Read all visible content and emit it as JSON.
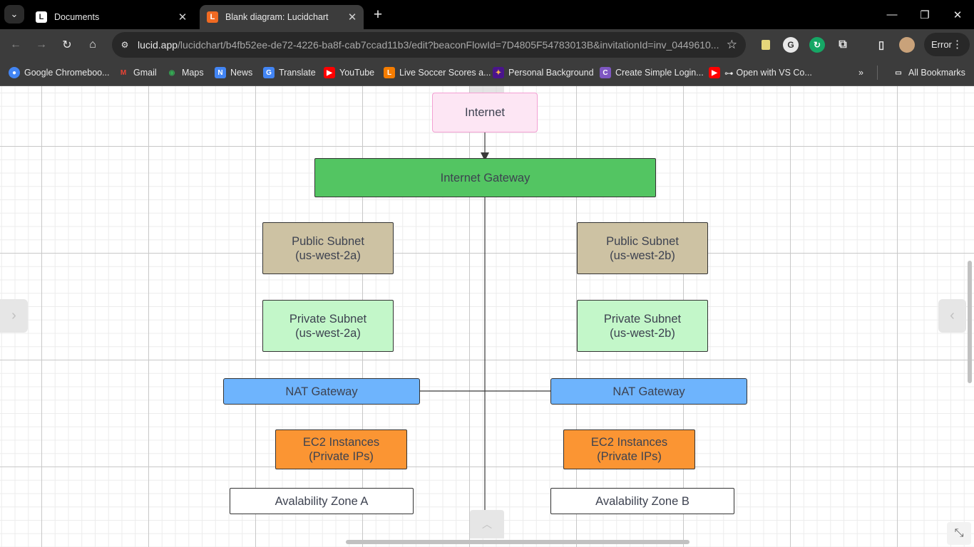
{
  "tabs": [
    {
      "title": "Documents",
      "favicon": "lucid-icon",
      "active": false
    },
    {
      "title": "Blank diagram: Lucidchart",
      "favicon": "lucid-orange-icon",
      "active": true
    }
  ],
  "omnibox": {
    "host": "lucid.app",
    "path": "/lucidchart/b4fb52ee-de72-4226-ba8f-cab7ccad11b3/edit?beaconFlowId=7D4805F54783013B&invitationId=inv_0449610..."
  },
  "profile": {
    "status": "Error"
  },
  "bookmarks": [
    {
      "label": "Google Chromeboo...",
      "icon": "chrome-icon",
      "color": "#4285f4"
    },
    {
      "label": "Gmail",
      "icon": "gmail-icon",
      "color": "#ea4335"
    },
    {
      "label": "Maps",
      "icon": "maps-icon",
      "color": "#34a853"
    },
    {
      "label": "News",
      "icon": "news-icon",
      "color": "#4285f4"
    },
    {
      "label": "Translate",
      "icon": "translate-icon",
      "color": "#4285f4"
    },
    {
      "label": "YouTube",
      "icon": "youtube-icon",
      "color": "#ff0000"
    },
    {
      "label": "Live Soccer Scores a...",
      "icon": "soccer-icon",
      "color": "#f57c00"
    },
    {
      "label": "Personal Background",
      "icon": "personal-icon",
      "color": "#7b1fa2"
    },
    {
      "label": "Create Simple Login...",
      "icon": "create-icon",
      "color": "#7e57c2"
    },
    {
      "label": "Open with VS Co...",
      "icon": "vscode-youtube-icon",
      "color": "#ff0000"
    }
  ],
  "all_bookmarks": "All Bookmarks",
  "diagram": {
    "internet": "Internet",
    "internet_gateway": "Internet Gateway",
    "public_subnet_a": [
      "Public Subnet",
      "(us-west-2a)"
    ],
    "public_subnet_b": [
      "Public Subnet",
      "(us-west-2b)"
    ],
    "private_subnet_a": [
      "Private Subnet",
      "(us-west-2a)"
    ],
    "private_subnet_b": [
      "Private Subnet",
      "(us-west-2b)"
    ],
    "nat_gateway_a": "NAT Gateway",
    "nat_gateway_b": "NAT Gateway",
    "ec2_a": [
      "EC2 Instances",
      "(Private IPs)"
    ],
    "ec2_b": [
      "EC2 Instances",
      "(Private IPs)"
    ],
    "az_a": "Avalability Zone A",
    "az_b": "Avalability Zone B",
    "colors": {
      "internet": "#fde6f4",
      "internet_gateway": "#53c562",
      "public_subnet": "#cdc2a3",
      "private_subnet": "#c3f7c9",
      "nat_gateway": "#6eb4fd",
      "ec2": "#fb9533"
    }
  }
}
